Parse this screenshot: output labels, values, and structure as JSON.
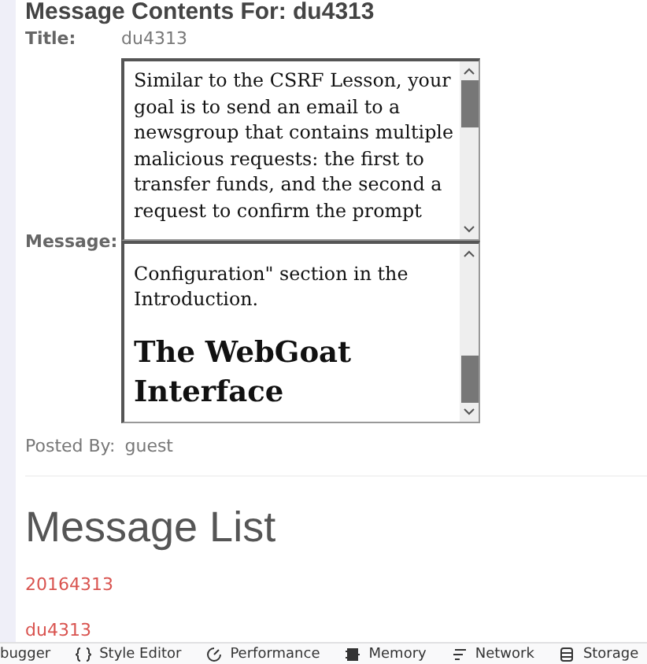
{
  "heading": "Message Contents For: du4313",
  "title_field": {
    "label": "Title:",
    "value": "du4313"
  },
  "message_field": {
    "label": "Message:",
    "frames": [
      {
        "blocks": [
          {
            "kind": "paragraph",
            "text": "Similar to the CSRF Lesson, your goal is to send an email to a newsgroup that contains multiple malicious requests: the first to transfer funds, and the second a request to confirm the prompt"
          }
        ]
      },
      {
        "blocks": [
          {
            "kind": "paragraph",
            "text": "Configuration\" section in the Introduction."
          },
          {
            "kind": "heading",
            "text": "The WebGoat Interface"
          }
        ]
      }
    ]
  },
  "posted_by": {
    "label": "Posted By:",
    "value": "guest"
  },
  "message_list": {
    "title": "Message List",
    "links": [
      "20164313",
      "du4313"
    ]
  },
  "devtools_tabs": [
    {
      "kind": "debugger",
      "label": "bugger"
    },
    {
      "kind": "style",
      "label": "Style Editor"
    },
    {
      "kind": "performance",
      "label": "Performance"
    },
    {
      "kind": "memory",
      "label": "Memory"
    },
    {
      "kind": "network",
      "label": "Network"
    },
    {
      "kind": "storage",
      "label": "Storage"
    }
  ]
}
